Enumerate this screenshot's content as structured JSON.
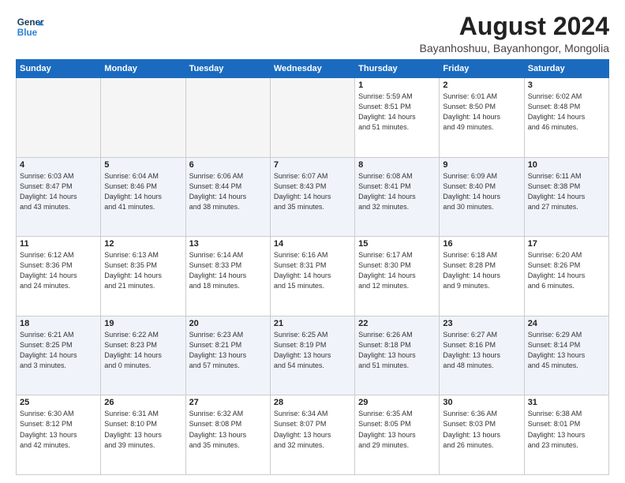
{
  "logo": {
    "line1": "General",
    "line2": "Blue"
  },
  "title": "August 2024",
  "subtitle": "Bayanhoshuu, Bayanhongor, Mongolia",
  "days_of_week": [
    "Sunday",
    "Monday",
    "Tuesday",
    "Wednesday",
    "Thursday",
    "Friday",
    "Saturday"
  ],
  "weeks": [
    [
      {
        "day": "",
        "info": ""
      },
      {
        "day": "",
        "info": ""
      },
      {
        "day": "",
        "info": ""
      },
      {
        "day": "",
        "info": ""
      },
      {
        "day": "1",
        "info": "Sunrise: 5:59 AM\nSunset: 8:51 PM\nDaylight: 14 hours\nand 51 minutes."
      },
      {
        "day": "2",
        "info": "Sunrise: 6:01 AM\nSunset: 8:50 PM\nDaylight: 14 hours\nand 49 minutes."
      },
      {
        "day": "3",
        "info": "Sunrise: 6:02 AM\nSunset: 8:48 PM\nDaylight: 14 hours\nand 46 minutes."
      }
    ],
    [
      {
        "day": "4",
        "info": "Sunrise: 6:03 AM\nSunset: 8:47 PM\nDaylight: 14 hours\nand 43 minutes."
      },
      {
        "day": "5",
        "info": "Sunrise: 6:04 AM\nSunset: 8:46 PM\nDaylight: 14 hours\nand 41 minutes."
      },
      {
        "day": "6",
        "info": "Sunrise: 6:06 AM\nSunset: 8:44 PM\nDaylight: 14 hours\nand 38 minutes."
      },
      {
        "day": "7",
        "info": "Sunrise: 6:07 AM\nSunset: 8:43 PM\nDaylight: 14 hours\nand 35 minutes."
      },
      {
        "day": "8",
        "info": "Sunrise: 6:08 AM\nSunset: 8:41 PM\nDaylight: 14 hours\nand 32 minutes."
      },
      {
        "day": "9",
        "info": "Sunrise: 6:09 AM\nSunset: 8:40 PM\nDaylight: 14 hours\nand 30 minutes."
      },
      {
        "day": "10",
        "info": "Sunrise: 6:11 AM\nSunset: 8:38 PM\nDaylight: 14 hours\nand 27 minutes."
      }
    ],
    [
      {
        "day": "11",
        "info": "Sunrise: 6:12 AM\nSunset: 8:36 PM\nDaylight: 14 hours\nand 24 minutes."
      },
      {
        "day": "12",
        "info": "Sunrise: 6:13 AM\nSunset: 8:35 PM\nDaylight: 14 hours\nand 21 minutes."
      },
      {
        "day": "13",
        "info": "Sunrise: 6:14 AM\nSunset: 8:33 PM\nDaylight: 14 hours\nand 18 minutes."
      },
      {
        "day": "14",
        "info": "Sunrise: 6:16 AM\nSunset: 8:31 PM\nDaylight: 14 hours\nand 15 minutes."
      },
      {
        "day": "15",
        "info": "Sunrise: 6:17 AM\nSunset: 8:30 PM\nDaylight: 14 hours\nand 12 minutes."
      },
      {
        "day": "16",
        "info": "Sunrise: 6:18 AM\nSunset: 8:28 PM\nDaylight: 14 hours\nand 9 minutes."
      },
      {
        "day": "17",
        "info": "Sunrise: 6:20 AM\nSunset: 8:26 PM\nDaylight: 14 hours\nand 6 minutes."
      }
    ],
    [
      {
        "day": "18",
        "info": "Sunrise: 6:21 AM\nSunset: 8:25 PM\nDaylight: 14 hours\nand 3 minutes."
      },
      {
        "day": "19",
        "info": "Sunrise: 6:22 AM\nSunset: 8:23 PM\nDaylight: 14 hours\nand 0 minutes."
      },
      {
        "day": "20",
        "info": "Sunrise: 6:23 AM\nSunset: 8:21 PM\nDaylight: 13 hours\nand 57 minutes."
      },
      {
        "day": "21",
        "info": "Sunrise: 6:25 AM\nSunset: 8:19 PM\nDaylight: 13 hours\nand 54 minutes."
      },
      {
        "day": "22",
        "info": "Sunrise: 6:26 AM\nSunset: 8:18 PM\nDaylight: 13 hours\nand 51 minutes."
      },
      {
        "day": "23",
        "info": "Sunrise: 6:27 AM\nSunset: 8:16 PM\nDaylight: 13 hours\nand 48 minutes."
      },
      {
        "day": "24",
        "info": "Sunrise: 6:29 AM\nSunset: 8:14 PM\nDaylight: 13 hours\nand 45 minutes."
      }
    ],
    [
      {
        "day": "25",
        "info": "Sunrise: 6:30 AM\nSunset: 8:12 PM\nDaylight: 13 hours\nand 42 minutes."
      },
      {
        "day": "26",
        "info": "Sunrise: 6:31 AM\nSunset: 8:10 PM\nDaylight: 13 hours\nand 39 minutes."
      },
      {
        "day": "27",
        "info": "Sunrise: 6:32 AM\nSunset: 8:08 PM\nDaylight: 13 hours\nand 35 minutes."
      },
      {
        "day": "28",
        "info": "Sunrise: 6:34 AM\nSunset: 8:07 PM\nDaylight: 13 hours\nand 32 minutes."
      },
      {
        "day": "29",
        "info": "Sunrise: 6:35 AM\nSunset: 8:05 PM\nDaylight: 13 hours\nand 29 minutes."
      },
      {
        "day": "30",
        "info": "Sunrise: 6:36 AM\nSunset: 8:03 PM\nDaylight: 13 hours\nand 26 minutes."
      },
      {
        "day": "31",
        "info": "Sunrise: 6:38 AM\nSunset: 8:01 PM\nDaylight: 13 hours\nand 23 minutes."
      }
    ]
  ]
}
